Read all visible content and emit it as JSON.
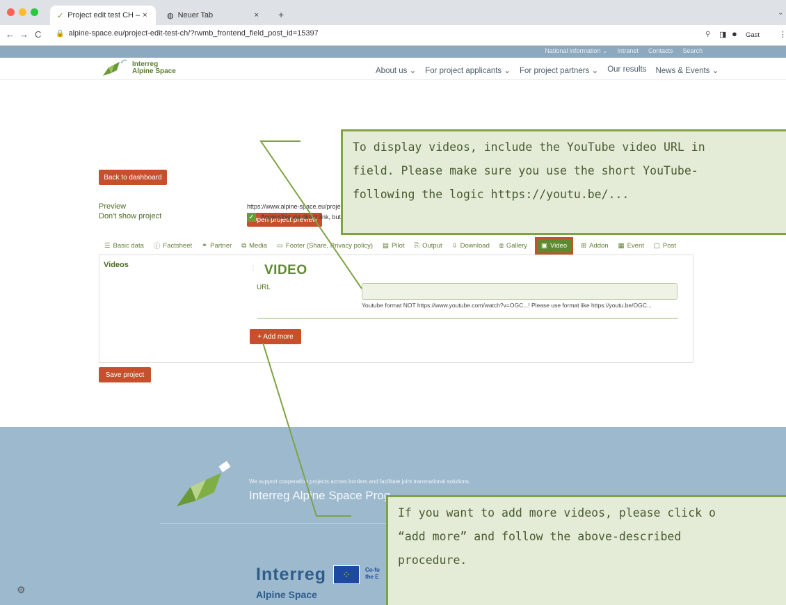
{
  "browser": {
    "tabs": [
      {
        "title": "Project edit test CH – Alpine Sp",
        "close": "×"
      },
      {
        "title": "Neuer Tab",
        "close": "×"
      }
    ],
    "new_tab": "+",
    "url": "alpine-space.eu/project-edit-test-ch/?rwmb_frontend_field_post_id=15397",
    "profile": "Gast"
  },
  "site": {
    "top_links": [
      "National information ⌄",
      "Intranet",
      "Contacts",
      "Search"
    ],
    "logo_line1": "Interreg",
    "logo_line2": "Alpine Space",
    "main_nav": [
      "About us ⌄",
      "For project applicants ⌄",
      "For project partners ⌄",
      "Our results",
      "News & Events ⌄"
    ]
  },
  "content": {
    "back_button": "Back to dashboard",
    "preview_label": "Preview",
    "preview_url": "https://www.alpine-space.eu/project",
    "open_preview_button": "Open project preview",
    "dont_show_label": "Don't show project",
    "accessible_text": "Accessible via direct link, but n",
    "tabs": [
      {
        "label": "Basic data",
        "icon": "list-icon"
      },
      {
        "label": "Factsheet",
        "icon": "info-icon"
      },
      {
        "label": "Partner",
        "icon": "handshake-icon"
      },
      {
        "label": "Media",
        "icon": "media-icon"
      },
      {
        "label": "Footer (Share, Privacy policy)",
        "icon": "footer-icon"
      },
      {
        "label": "Pilot",
        "icon": "pilot-icon"
      },
      {
        "label": "Output",
        "icon": "output-icon"
      },
      {
        "label": "Download",
        "icon": "download-icon"
      },
      {
        "label": "Gallery",
        "icon": "gallery-icon"
      },
      {
        "label": "Video",
        "icon": "video-icon",
        "active": true
      },
      {
        "label": "Addon",
        "icon": "addon-icon"
      },
      {
        "label": "Event",
        "icon": "calendar-icon"
      },
      {
        "label": "Post",
        "icon": "post-icon"
      }
    ],
    "videos_label": "Videos",
    "video_heading": "VIDEO",
    "url_label": "URL",
    "url_value": "",
    "url_hint": "Youtube format NOT https://www.youtube.com/watch?v=OGC...! Please use format like https://youtu.be/OGC...",
    "add_more_button": "+ Add more",
    "save_button": "Save project"
  },
  "footer": {
    "tagline": "We support cooperation projects across borders and facilitate joint transnational solutions.",
    "title": "Interreg Alpine Space Prog",
    "brand_word": "Interreg",
    "brand_sub": "Alpine Space",
    "cofund_line1": "Co-fu",
    "cofund_line2": "the E"
  },
  "callouts": {
    "top": [
      "To display videos, include the YouTube video URL in",
      "field. Please make sure you use the short YouTube-",
      "following the logic https://youtu.be/..."
    ],
    "bottom": [
      "If you want to add more videos, please click o",
      "“add more” and follow the above-described",
      "procedure."
    ]
  }
}
